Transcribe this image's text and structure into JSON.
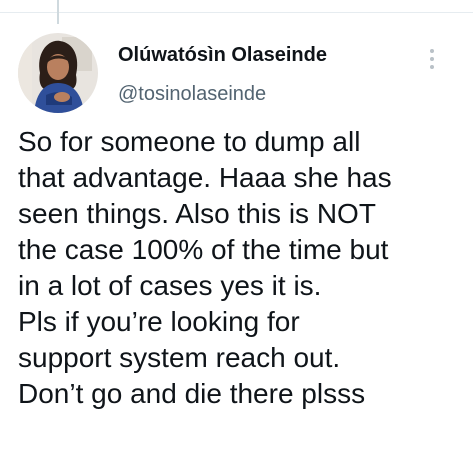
{
  "tweet": {
    "author": {
      "display_name": "Olúwatósìn Olaseinde",
      "handle": "@tosinolaseinde"
    },
    "icons": {
      "more": "more-vertical-icon",
      "avatar": "profile-photo"
    },
    "colors": {
      "text": "#0f1419",
      "secondary_text": "#536471",
      "divider": "#e6ecf0"
    },
    "lines": [
      "So for someone to dump all",
      "that advantage. Haaa she has",
      "seen things. Also this is NOT",
      "the case 100% of the time but",
      "in a lot of cases yes it is.",
      "Pls if you’re looking for",
      "support system reach out.",
      "Don’t go and die there plsss"
    ]
  }
}
